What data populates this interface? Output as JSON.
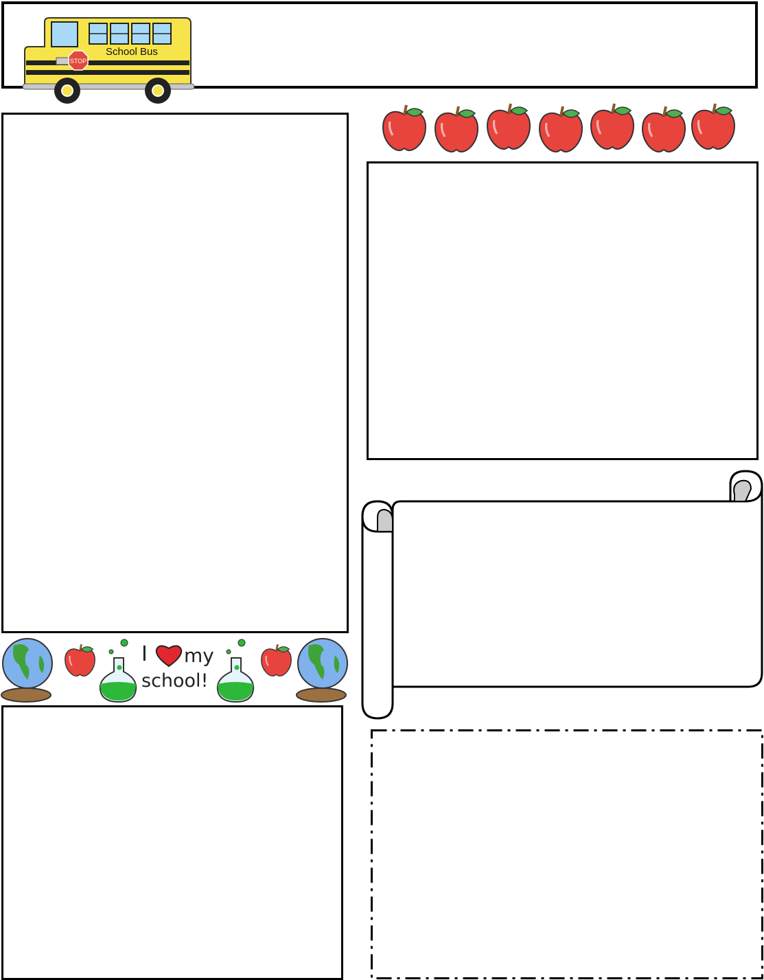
{
  "header": {
    "bus_label": "School Bus",
    "stop_sign": "STOP"
  },
  "banner": {
    "line1_i": "I",
    "line1_my": "my",
    "line2": "school!"
  },
  "apples_count": 7,
  "colors": {
    "bus_yellow": "#f7e44a",
    "apple_red": "#e8443e",
    "leaf_green": "#4caf50",
    "globe_blue": "#7fb2ec",
    "flask_green": "#2db83a"
  }
}
